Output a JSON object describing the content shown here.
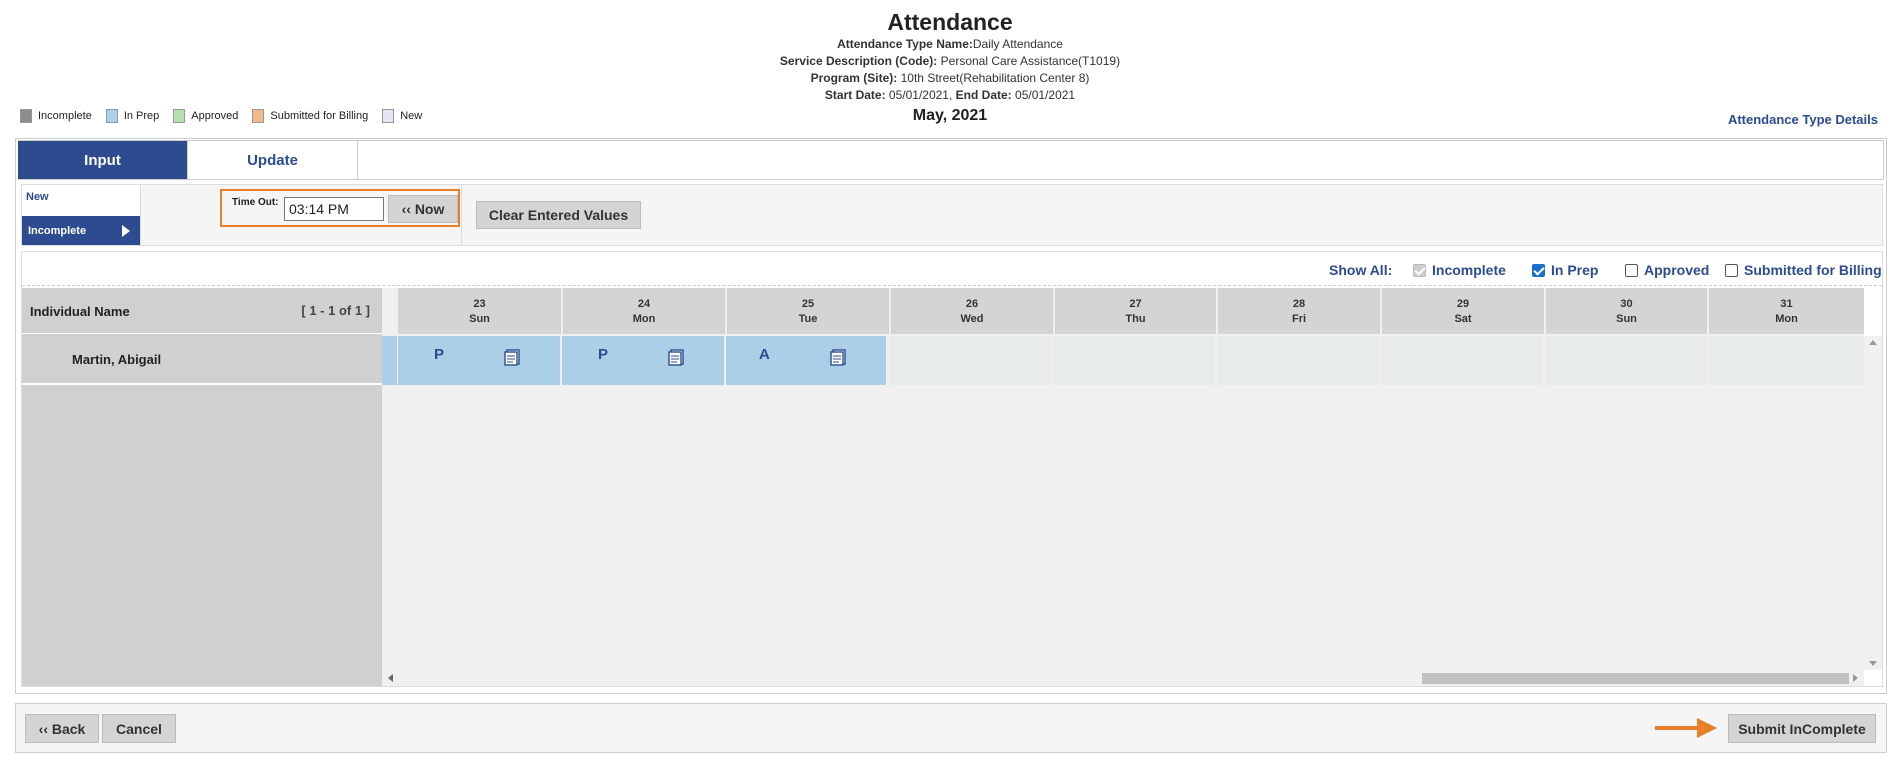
{
  "header": {
    "title": "Attendance",
    "attendance_type_label": "Attendance Type Name:",
    "attendance_type_value": "Daily Attendance",
    "service_label": "Service Description (Code):",
    "service_value": "Personal Care Assistance(T1019)",
    "program_label": "Program (Site):",
    "program_value": "10th Street(Rehabilitation Center 8)",
    "start_label": "Start Date:",
    "start_value": "05/01/2021,",
    "end_label": "End Date:",
    "end_value": "05/01/2021",
    "month": "May, 2021"
  },
  "legend": [
    {
      "label": "Incomplete",
      "color": "#8c8c8c"
    },
    {
      "label": "In Prep",
      "color": "#abcfe6"
    },
    {
      "label": "Approved",
      "color": "#b7e0b0"
    },
    {
      "label": "Submitted for Billing",
      "color": "#f2b98a"
    },
    {
      "label": "New",
      "color": "#e6e3f5"
    }
  ],
  "attendance_type_details_link": "Attendance Type Details",
  "tabs": [
    {
      "label": "Input",
      "active": true
    },
    {
      "label": "Update",
      "active": false
    }
  ],
  "status_list": {
    "new": "New",
    "incomplete": "Incomplete"
  },
  "time_out": {
    "label": "Time Out:",
    "value": "03:14 PM",
    "now_button": "‹‹ Now"
  },
  "clear_button": "Clear Entered Values",
  "show_all": {
    "label": "Show All:",
    "options": [
      {
        "label": "Incomplete",
        "checked": true,
        "disabled": true
      },
      {
        "label": "In Prep",
        "checked": true,
        "disabled": false
      },
      {
        "label": "Approved",
        "checked": false,
        "disabled": false
      },
      {
        "label": "Submitted for Billing",
        "checked": false,
        "disabled": false
      }
    ]
  },
  "grid": {
    "name_header": "Individual Name",
    "paging": "[ 1 - 1 of 1 ]",
    "days": [
      {
        "num": "23",
        "dow": "Sun"
      },
      {
        "num": "24",
        "dow": "Mon"
      },
      {
        "num": "25",
        "dow": "Tue"
      },
      {
        "num": "26",
        "dow": "Wed"
      },
      {
        "num": "27",
        "dow": "Thu"
      },
      {
        "num": "28",
        "dow": "Fri"
      },
      {
        "num": "29",
        "dow": "Sat"
      },
      {
        "num": "30",
        "dow": "Sun"
      },
      {
        "num": "31",
        "dow": "Mon"
      }
    ],
    "rows": [
      {
        "name": "Martin, Abigail",
        "cells": [
          "P",
          "P",
          "A",
          "",
          "",
          "",
          "",
          "",
          ""
        ]
      }
    ]
  },
  "footer": {
    "back": "‹‹ Back",
    "cancel": "Cancel",
    "submit": "Submit InComplete"
  },
  "colors": {
    "primary": "#2d4c8f",
    "highlight": "#e8802a",
    "in_prep": "#abcfe6"
  },
  "icons": [
    "note-icon"
  ]
}
